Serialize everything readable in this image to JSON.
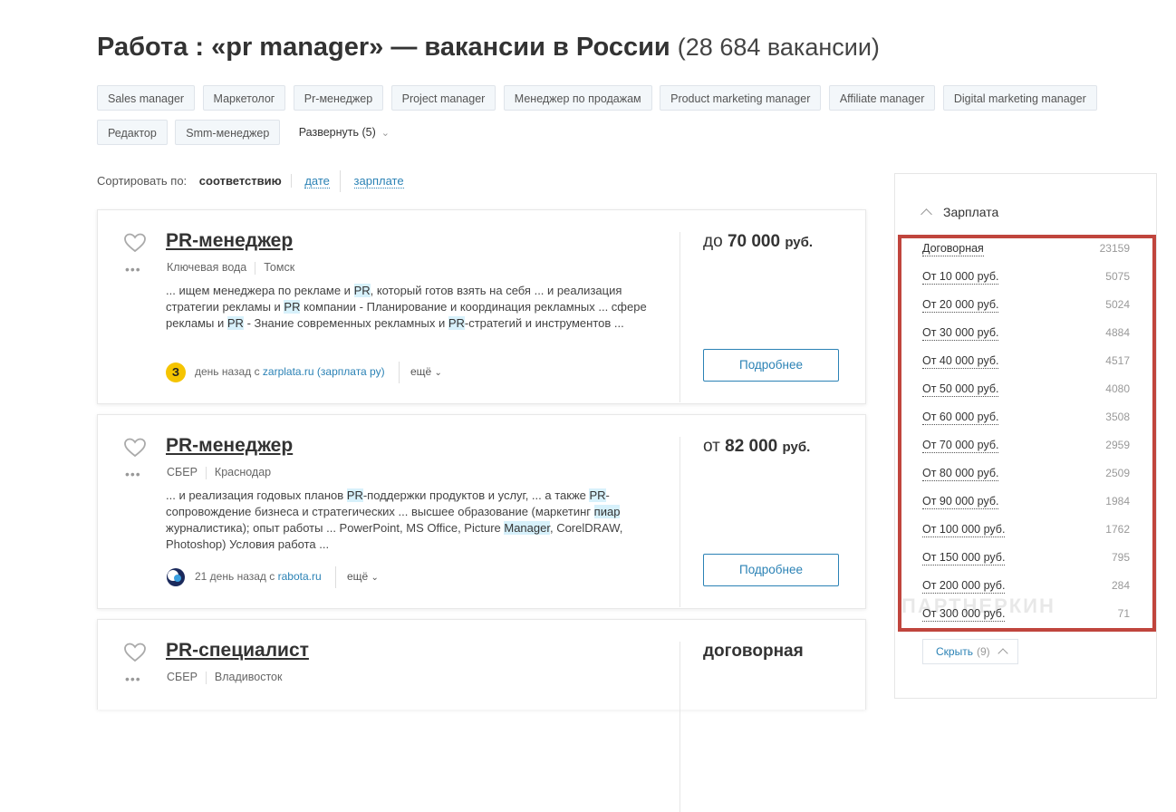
{
  "page": {
    "title": "Работа : «pr manager» — вакансии в России",
    "count": "(28 684 вакансии)"
  },
  "tags": [
    "Sales manager",
    "Маркетолог",
    "Pr-менеджер",
    "Project manager",
    "Менеджер по продажам",
    "Product marketing manager",
    "Affiliate manager",
    "Digital marketing manager",
    "Редактор",
    "Smm-менеджер"
  ],
  "expand_label": "Развернуть (5)",
  "sort": {
    "label": "Сортировать по:",
    "current": "соответствию",
    "options": [
      "дате",
      "зарплате"
    ]
  },
  "vacancies": [
    {
      "title": "PR-менеджер",
      "company": "Ключевая вода",
      "city": "Томск",
      "salary_prefix": "до",
      "salary_amount": "70 000",
      "salary_unit": "руб.",
      "desc": [
        {
          "t": "... ищем менеджера по рекламе и "
        },
        {
          "t": "PR",
          "h": true
        },
        {
          "t": ", который готов взять на себя ... и реализация стратегии рекламы и "
        },
        {
          "t": "PR",
          "h": true
        },
        {
          "t": " компании - Планирование и координация рекламных ... сфере рекламы и "
        },
        {
          "t": "PR",
          "h": true
        },
        {
          "t": " - Знание современных рекламных и "
        },
        {
          "t": "PR",
          "h": true
        },
        {
          "t": "-стратегий и инструментов ..."
        }
      ],
      "source_time": "день назад с ",
      "source_name": "zarplata.ru (зарплата ру)",
      "source_logo_text": "З",
      "more_label": "ещё",
      "button": "Подробнее"
    },
    {
      "title": "PR-менеджер",
      "company": "СБЕР",
      "city": "Краснодар",
      "salary_prefix": "от",
      "salary_amount": "82 000",
      "salary_unit": "руб.",
      "desc": [
        {
          "t": "... и реализация годовых планов "
        },
        {
          "t": "PR",
          "h": true
        },
        {
          "t": "-поддержки продуктов и услуг, ... а также "
        },
        {
          "t": "PR",
          "h": true
        },
        {
          "t": "-сопровождение бизнеса и стратегических ... высшее образование (маркетинг "
        },
        {
          "t": "пиар",
          "h": true
        },
        {
          "t": " журналистика); опыт работы ... PowerPoint, MS Office, Picture "
        },
        {
          "t": "Manager",
          "h": true
        },
        {
          "t": ", CorelDRAW, Photoshop) Условия работа ..."
        }
      ],
      "source_time": "21 день назад с ",
      "source_name": "rabota.ru",
      "source_logo_text": "",
      "more_label": "ещё",
      "button": "Подробнее"
    },
    {
      "title": "PR-специалист",
      "company": "СБЕР",
      "city": "Владивосток",
      "salary_text": "договорная"
    }
  ],
  "salary_filter": {
    "title": "Зарплата",
    "items": [
      {
        "label": "Договорная",
        "count": "23159"
      },
      {
        "label": "От 10 000 руб.",
        "count": "5075"
      },
      {
        "label": "От 20 000 руб.",
        "count": "5024"
      },
      {
        "label": "От 30 000 руб.",
        "count": "4884"
      },
      {
        "label": "От 40 000 руб.",
        "count": "4517"
      },
      {
        "label": "От 50 000 руб.",
        "count": "4080"
      },
      {
        "label": "От 60 000 руб.",
        "count": "3508"
      },
      {
        "label": "От 70 000 руб.",
        "count": "2959"
      },
      {
        "label": "От 80 000 руб.",
        "count": "2509"
      },
      {
        "label": "От 90 000 руб.",
        "count": "1984"
      },
      {
        "label": "От 100 000 руб.",
        "count": "1762"
      },
      {
        "label": "От 150 000 руб.",
        "count": "795"
      },
      {
        "label": "От 200 000 руб.",
        "count": "284"
      },
      {
        "label": "От 300 000 руб.",
        "count": "71"
      }
    ],
    "collapse_label": "Скрыть",
    "collapse_count": "(9)"
  },
  "watermark": "ПАРТНЕРКИН",
  "colors": {
    "accent": "#2b82b5",
    "highlight": "#d7f1fb",
    "annotation": "#c0453d"
  }
}
